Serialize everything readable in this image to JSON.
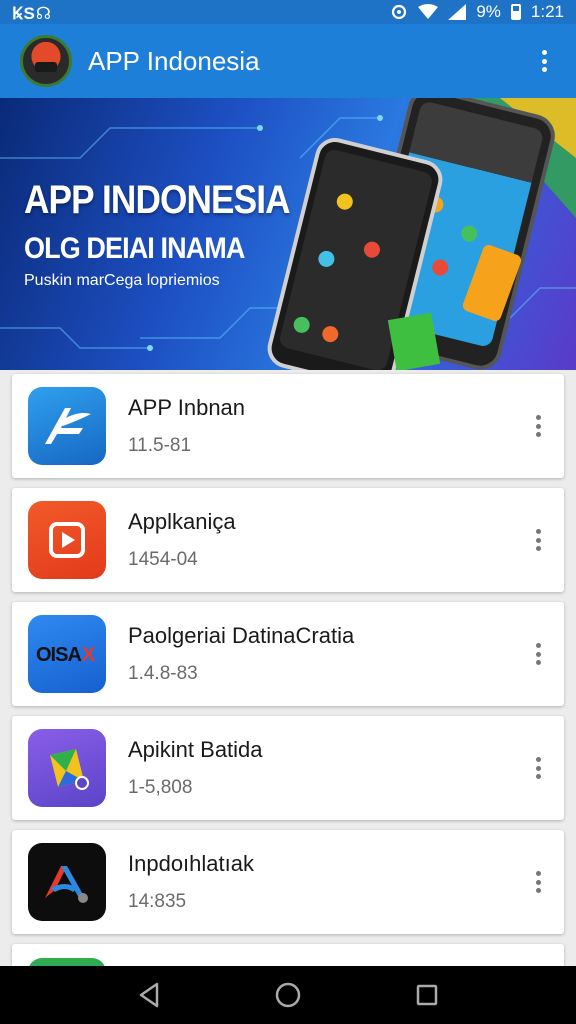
{
  "status_bar": {
    "left_text": "ꝂS☊",
    "battery": "9%",
    "time": "1:21"
  },
  "app_bar": {
    "title": "APP Indonesia",
    "logo_icon": "app-logo-icon",
    "overflow_icon": "more-vert-icon"
  },
  "banner": {
    "headline": "APP INDONESIA",
    "subheadline": "OLG DEIAI INAMA",
    "caption": "Puskin marCega lopriemios"
  },
  "apps": [
    {
      "name": "APP Inbnan",
      "version": "11.5-81",
      "icon": "feather-a-icon",
      "icon_color": "#1f86d8"
    },
    {
      "name": "Applkaniça",
      "version": "1454-04",
      "icon": "play-icon",
      "icon_color": "#ef4a22"
    },
    {
      "name": "Paolgeriai DatinaCratia",
      "version": "1.4.8-83",
      "icon": "oisax-icon",
      "icon_color": "#1d7ae0"
    },
    {
      "name": "Apikint Batida",
      "version": "1-5,808",
      "icon": "map-fold-icon",
      "icon_color": "#7a5ad8"
    },
    {
      "name": "Inpdoıhlatıak",
      "version": "14:835",
      "icon": "a-logo-icon",
      "icon_color": "#111111"
    }
  ],
  "nav_bar": {
    "back_icon": "back-icon",
    "home_icon": "home-icon",
    "recents_icon": "recents-icon"
  }
}
